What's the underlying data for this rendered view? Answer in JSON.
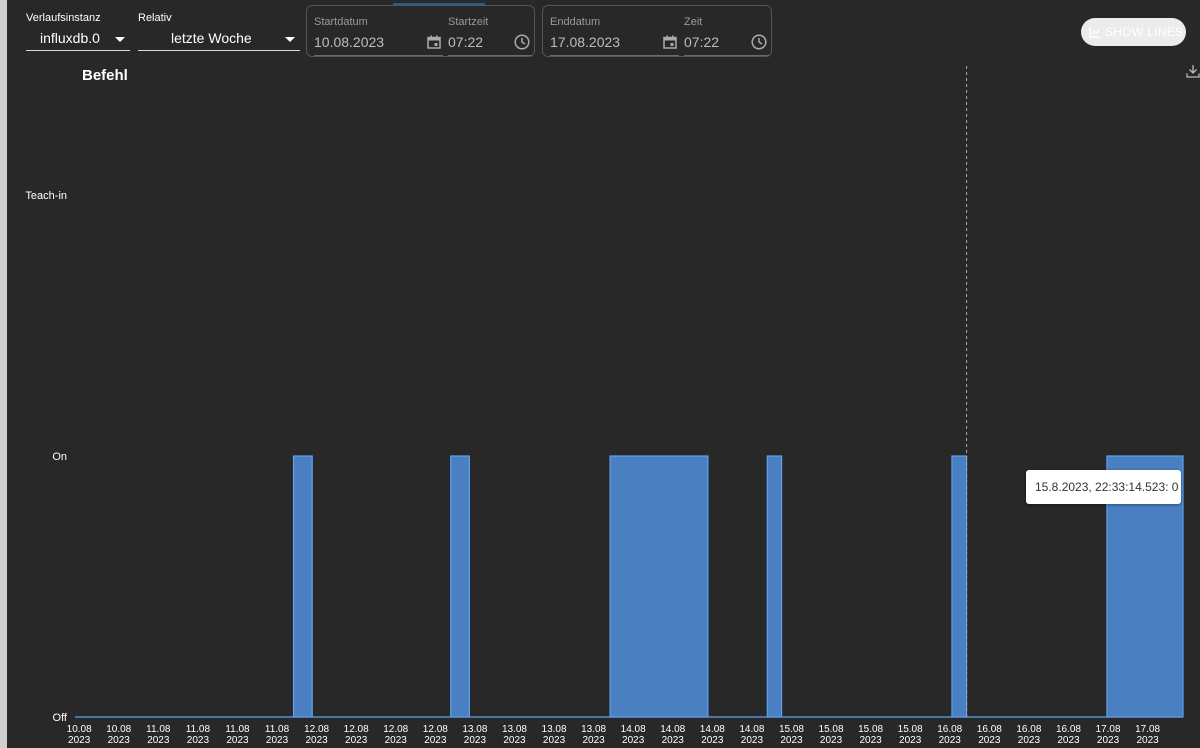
{
  "toolbar": {
    "instance_label": "Verlaufsinstanz",
    "instance_value": "influxdb.0",
    "relative_label": "Relativ",
    "relative_value": "letzte Woche",
    "start": {
      "date_label": "Startdatum",
      "date_value": "10.08.2023",
      "time_label": "Startzeit",
      "time_value": "07:22"
    },
    "end": {
      "date_label": "Enddatum",
      "date_value": "17.08.2023",
      "time_label": "Zeit",
      "time_value": "07:22"
    },
    "show_lines_label": "SHOW LINES"
  },
  "icons": {
    "dropdown": "chevron-down-icon",
    "calendar": "calendar-icon",
    "clock": "clock-icon",
    "show_lines": "line-chart-icon",
    "download": "download-icon"
  },
  "tooltip": {
    "text": "15.8.2023, 22:33:14.523: 0"
  },
  "chart_data": {
    "type": "area",
    "title": "Befehl",
    "step": true,
    "x_unit": "datetime",
    "xlim": [
      "2023-08-10 07:22",
      "2023-08-17 07:22"
    ],
    "y_categories": [
      "Off",
      "On",
      "Teach-in"
    ],
    "y_ticks": [
      {
        "label": "Off",
        "value": 0
      },
      {
        "label": "On",
        "value": 1
      },
      {
        "label": "Teach-in",
        "value": 2
      }
    ],
    "x_ticks": [
      {
        "date": "10.08",
        "year": "2023",
        "t": "2023-08-10 08:00"
      },
      {
        "date": "10.08",
        "year": "2023",
        "t": "2023-08-10 14:00"
      },
      {
        "date": "11.08",
        "year": "2023",
        "t": "2023-08-10 20:00"
      },
      {
        "date": "11.08",
        "year": "2023",
        "t": "2023-08-11 02:00"
      },
      {
        "date": "11.08",
        "year": "2023",
        "t": "2023-08-11 08:00"
      },
      {
        "date": "11.08",
        "year": "2023",
        "t": "2023-08-11 14:00"
      },
      {
        "date": "12.08",
        "year": "2023",
        "t": "2023-08-11 20:00"
      },
      {
        "date": "12.08",
        "year": "2023",
        "t": "2023-08-12 02:00"
      },
      {
        "date": "12.08",
        "year": "2023",
        "t": "2023-08-12 08:00"
      },
      {
        "date": "12.08",
        "year": "2023",
        "t": "2023-08-12 14:00"
      },
      {
        "date": "13.08",
        "year": "2023",
        "t": "2023-08-12 20:00"
      },
      {
        "date": "13.08",
        "year": "2023",
        "t": "2023-08-13 02:00"
      },
      {
        "date": "13.08",
        "year": "2023",
        "t": "2023-08-13 08:00"
      },
      {
        "date": "13.08",
        "year": "2023",
        "t": "2023-08-13 14:00"
      },
      {
        "date": "14.08",
        "year": "2023",
        "t": "2023-08-13 20:00"
      },
      {
        "date": "14.08",
        "year": "2023",
        "t": "2023-08-14 02:00"
      },
      {
        "date": "14.08",
        "year": "2023",
        "t": "2023-08-14 08:00"
      },
      {
        "date": "14.08",
        "year": "2023",
        "t": "2023-08-14 14:00"
      },
      {
        "date": "15.08",
        "year": "2023",
        "t": "2023-08-14 20:00"
      },
      {
        "date": "15.08",
        "year": "2023",
        "t": "2023-08-15 02:00"
      },
      {
        "date": "15.08",
        "year": "2023",
        "t": "2023-08-15 08:00"
      },
      {
        "date": "15.08",
        "year": "2023",
        "t": "2023-08-15 14:00"
      },
      {
        "date": "16.08",
        "year": "2023",
        "t": "2023-08-15 20:00"
      },
      {
        "date": "16.08",
        "year": "2023",
        "t": "2023-08-16 02:00"
      },
      {
        "date": "16.08",
        "year": "2023",
        "t": "2023-08-16 08:00"
      },
      {
        "date": "16.08",
        "year": "2023",
        "t": "2023-08-16 14:00"
      },
      {
        "date": "17.08",
        "year": "2023",
        "t": "2023-08-16 20:00"
      },
      {
        "date": "17.08",
        "year": "2023",
        "t": "2023-08-17 02:00"
      }
    ],
    "on_intervals": [
      {
        "start": "2023-08-11 16:30",
        "end": "2023-08-11 19:20",
        "value": 1
      },
      {
        "start": "2023-08-12 16:20",
        "end": "2023-08-12 19:10",
        "value": 1
      },
      {
        "start": "2023-08-13 16:30",
        "end": "2023-08-14 07:20",
        "value": 1
      },
      {
        "start": "2023-08-14 16:20",
        "end": "2023-08-14 18:30",
        "value": 1
      },
      {
        "start": "2023-08-15 20:20",
        "end": "2023-08-15 22:33",
        "value": 1
      },
      {
        "start": "2023-08-16 19:50",
        "end": "2023-08-17 07:22",
        "value": 1
      }
    ],
    "cursor_time": "2023-08-15 22:33:14.523",
    "colors": {
      "fill": "#4a7fc1",
      "stroke": "#5ea1ee",
      "background": "#282828",
      "text": "#ffffff"
    }
  }
}
